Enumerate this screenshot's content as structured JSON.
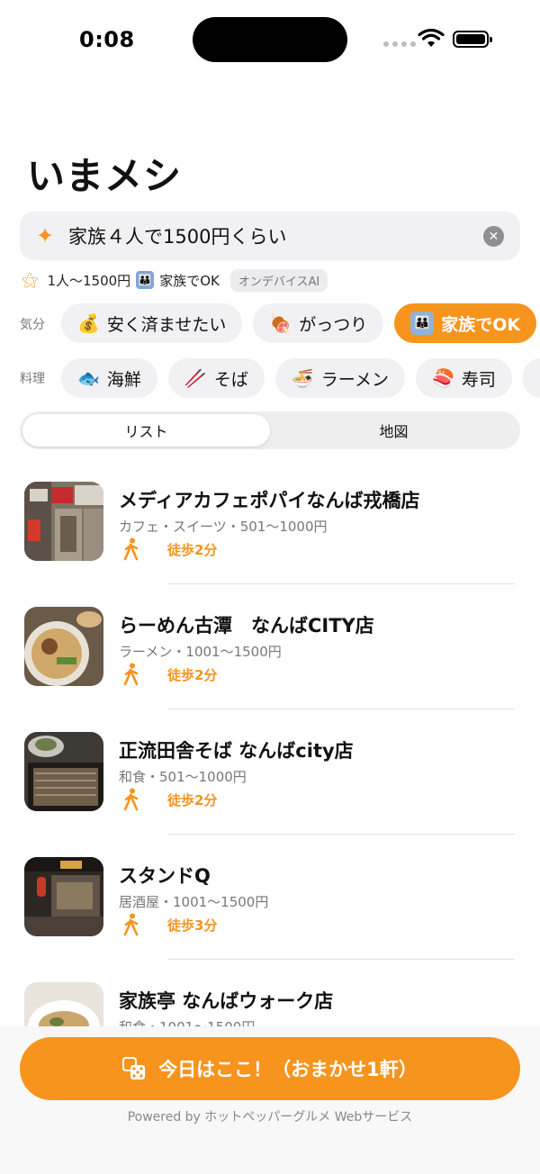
{
  "status": {
    "time": "0:08"
  },
  "title": "いまメシ",
  "search": {
    "query": "家族４人で1500円くらい"
  },
  "summary": {
    "budget": "1人〜1500円",
    "family": "家族でOK",
    "ai_badge": "オンデバイスAI"
  },
  "mood": {
    "label": "気分",
    "chips": [
      {
        "emoji": "💰",
        "label": "安く済ませたい",
        "active": false
      },
      {
        "emoji": "🍖",
        "label": "がっつり",
        "active": false
      },
      {
        "emoji": "👪",
        "label": "家族でOK",
        "active": true
      }
    ]
  },
  "cuisine": {
    "label": "料理",
    "chips": [
      {
        "emoji": "🐟",
        "label": "海鮮"
      },
      {
        "emoji": "🥢",
        "label": "そば"
      },
      {
        "emoji": "🍜",
        "label": "ラーメン"
      },
      {
        "emoji": "🍣",
        "label": "寿司"
      }
    ]
  },
  "tabs": {
    "list": "リスト",
    "map": "地図",
    "selected": "list"
  },
  "restaurants": [
    {
      "name": "メディアカフェポパイなんば戎橋店",
      "meta": "カフェ・スイーツ・501〜1000円",
      "walk": "徒歩2分"
    },
    {
      "name": "らーめん古潭　なんばCITY店",
      "meta": "ラーメン・1001〜1500円",
      "walk": "徒歩2分"
    },
    {
      "name": "正流田舎そば なんばcity店",
      "meta": "和食・501〜1000円",
      "walk": "徒歩2分"
    },
    {
      "name": "スタンドQ",
      "meta": "居酒屋・1001〜1500円",
      "walk": "徒歩3分"
    },
    {
      "name": "家族亭 なんばウォーク店",
      "meta": "和食・1001〜1500円",
      "walk": ""
    }
  ],
  "cta": {
    "label": "今日はここ！（おまかせ1軒）"
  },
  "footer": {
    "powered": "Powered by ホットペッパーグルメ Webサービス"
  },
  "colors": {
    "accent": "#f7941d",
    "chip_bg": "#f1f1f3",
    "muted": "#777777"
  }
}
